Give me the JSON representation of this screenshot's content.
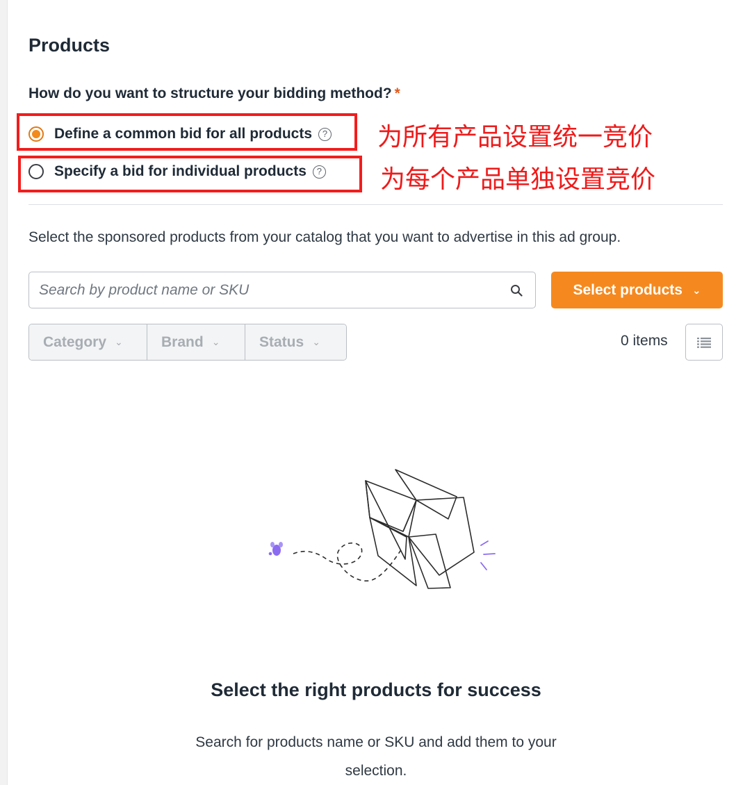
{
  "section": {
    "title": "Products"
  },
  "bidding": {
    "question": "How do you want to structure your bidding method?",
    "required_mark": "*",
    "options": [
      {
        "label": "Define a common bid for all products",
        "selected": true
      },
      {
        "label": "Specify a bid for individual products",
        "selected": false
      }
    ],
    "help_glyph": "?"
  },
  "annotations": {
    "common_bid": "为所有产品设置统一竞价",
    "individual_bid": "为每个产品单独设置竞价",
    "box_color": "#f21d1d"
  },
  "catalog": {
    "description": "Select the sponsored products from your catalog that you want to advertise in this ad group.",
    "search_placeholder": "Search by product name or SKU",
    "search_value": "",
    "select_button_label": "Select products",
    "filters": {
      "category": "Category",
      "brand": "Brand",
      "status": "Status"
    },
    "items_count": "0 items"
  },
  "empty_state": {
    "title": "Select the right products for success",
    "description": "Search for products name or SKU and add them to your selection."
  },
  "colors": {
    "accent": "#f5891f",
    "required": "#e15a1d",
    "annotation": "#ee1b1b"
  },
  "icons": {
    "search": "search-icon",
    "chevron": "chevron-down-icon",
    "help": "help-circle-icon",
    "list_view": "list-view-icon"
  }
}
